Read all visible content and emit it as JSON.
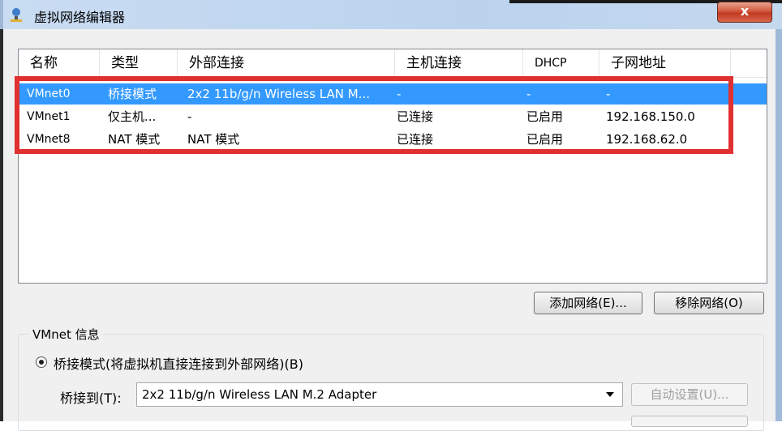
{
  "window": {
    "title": "虚拟网络编辑器",
    "close_label": "x"
  },
  "list": {
    "columns": [
      "名称",
      "类型",
      "外部连接",
      "主机连接",
      "DHCP",
      "子网地址"
    ],
    "rows": [
      [
        "VMnet0",
        "桥接模式",
        "2x2 11b/g/n Wireless LAN M...",
        "-",
        "-",
        "-"
      ],
      [
        "VMnet1",
        "仅主机...",
        "-",
        "已连接",
        "已启用",
        "192.168.150.0"
      ],
      [
        "VMnet8",
        "NAT 模式",
        "NAT 模式",
        "已连接",
        "已启用",
        "192.168.62.0"
      ]
    ],
    "selected_row": 0
  },
  "buttons": {
    "add_network": "添加网络(E)...",
    "remove_network": "移除网络(O)"
  },
  "vmnet_info": {
    "group_label": "VMnet 信息",
    "bridged_radio_label": "桥接模式(将虚拟机直接连接到外部网络)(B)",
    "bridged_to_label": "桥接到(T):",
    "bridged_to_value": "2x2 11b/g/n Wireless LAN M.2 Adapter",
    "auto_settings": "自动设置(U)..."
  },
  "colors": {
    "selection": "#3399ff",
    "highlight_box": "#e03030"
  }
}
